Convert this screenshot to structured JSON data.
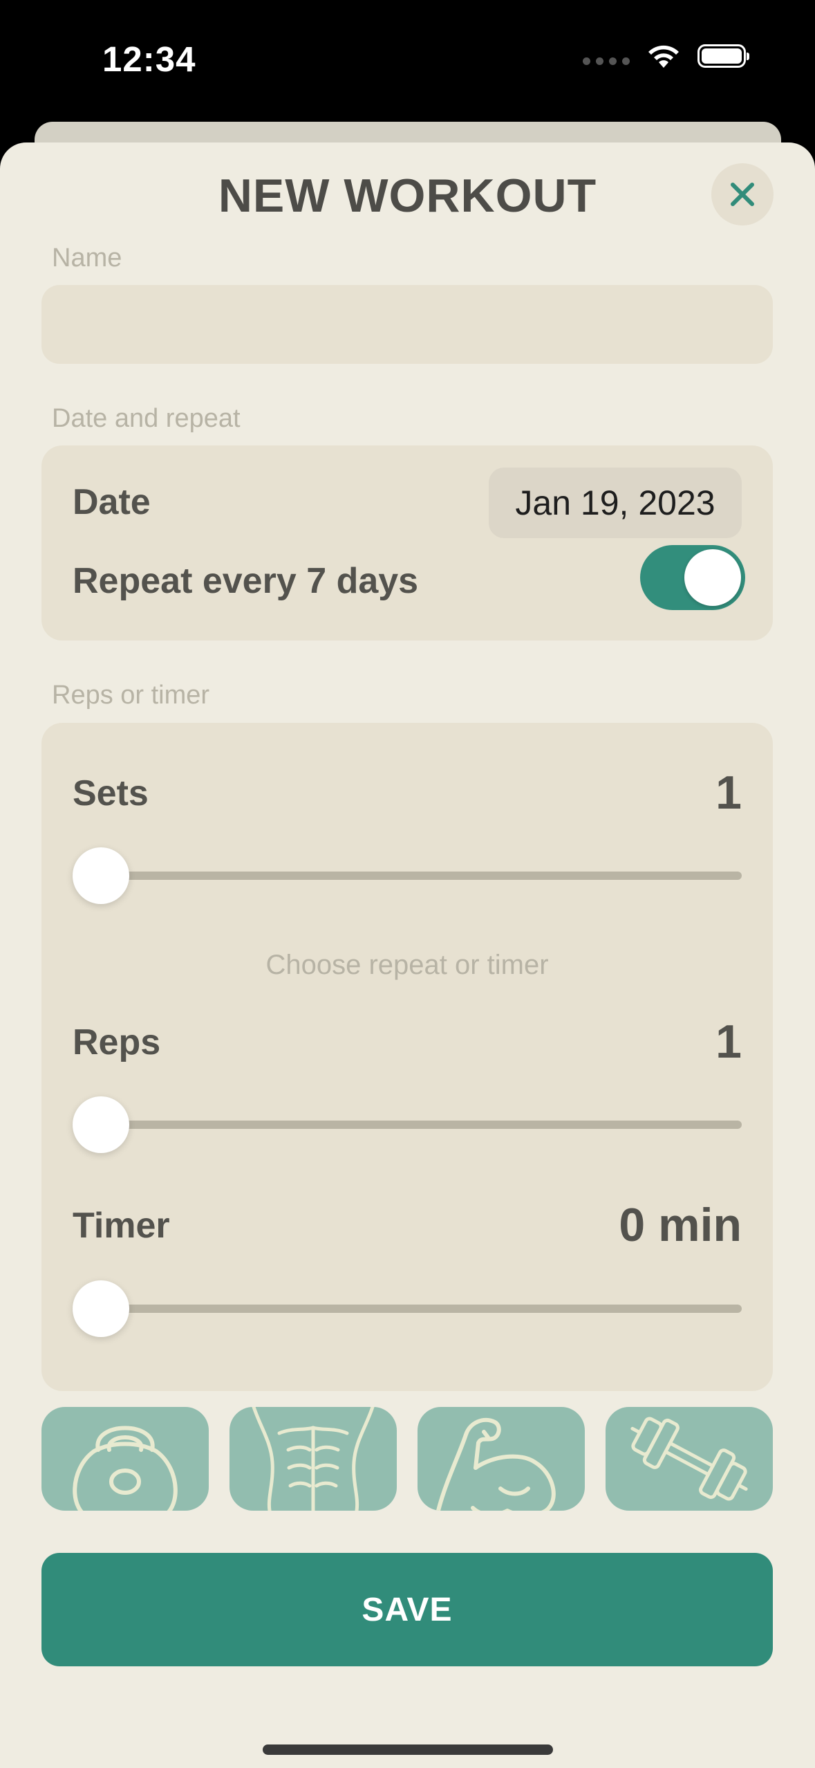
{
  "status_bar": {
    "time": "12:34"
  },
  "header": {
    "title": "NEW WORKOUT",
    "close_icon": "close-icon"
  },
  "name_section": {
    "label": "Name",
    "value": "",
    "placeholder": ""
  },
  "date_section": {
    "label": "Date and repeat",
    "date_label": "Date",
    "date_value": "Jan 19, 2023",
    "repeat_label": "Repeat every 7 days",
    "repeat_enabled": true
  },
  "reps_section": {
    "label": "Reps or timer",
    "sets_label": "Sets",
    "sets_value": "1",
    "sets_slider_fraction": 0,
    "hint": "Choose repeat or timer",
    "reps_label": "Reps",
    "reps_value": "1",
    "reps_slider_fraction": 0,
    "timer_label": "Timer",
    "timer_value": "0 min",
    "timer_slider_fraction": 0
  },
  "workout_icons": [
    "kettlebell-icon",
    "abs-icon",
    "biceps-icon",
    "dumbbell-icon"
  ],
  "colors": {
    "accent": "#318c7a",
    "tile": "#92bdaf",
    "background": "#efece1",
    "card": "#e7e1d1"
  },
  "actions": {
    "save_label": "SAVE"
  }
}
